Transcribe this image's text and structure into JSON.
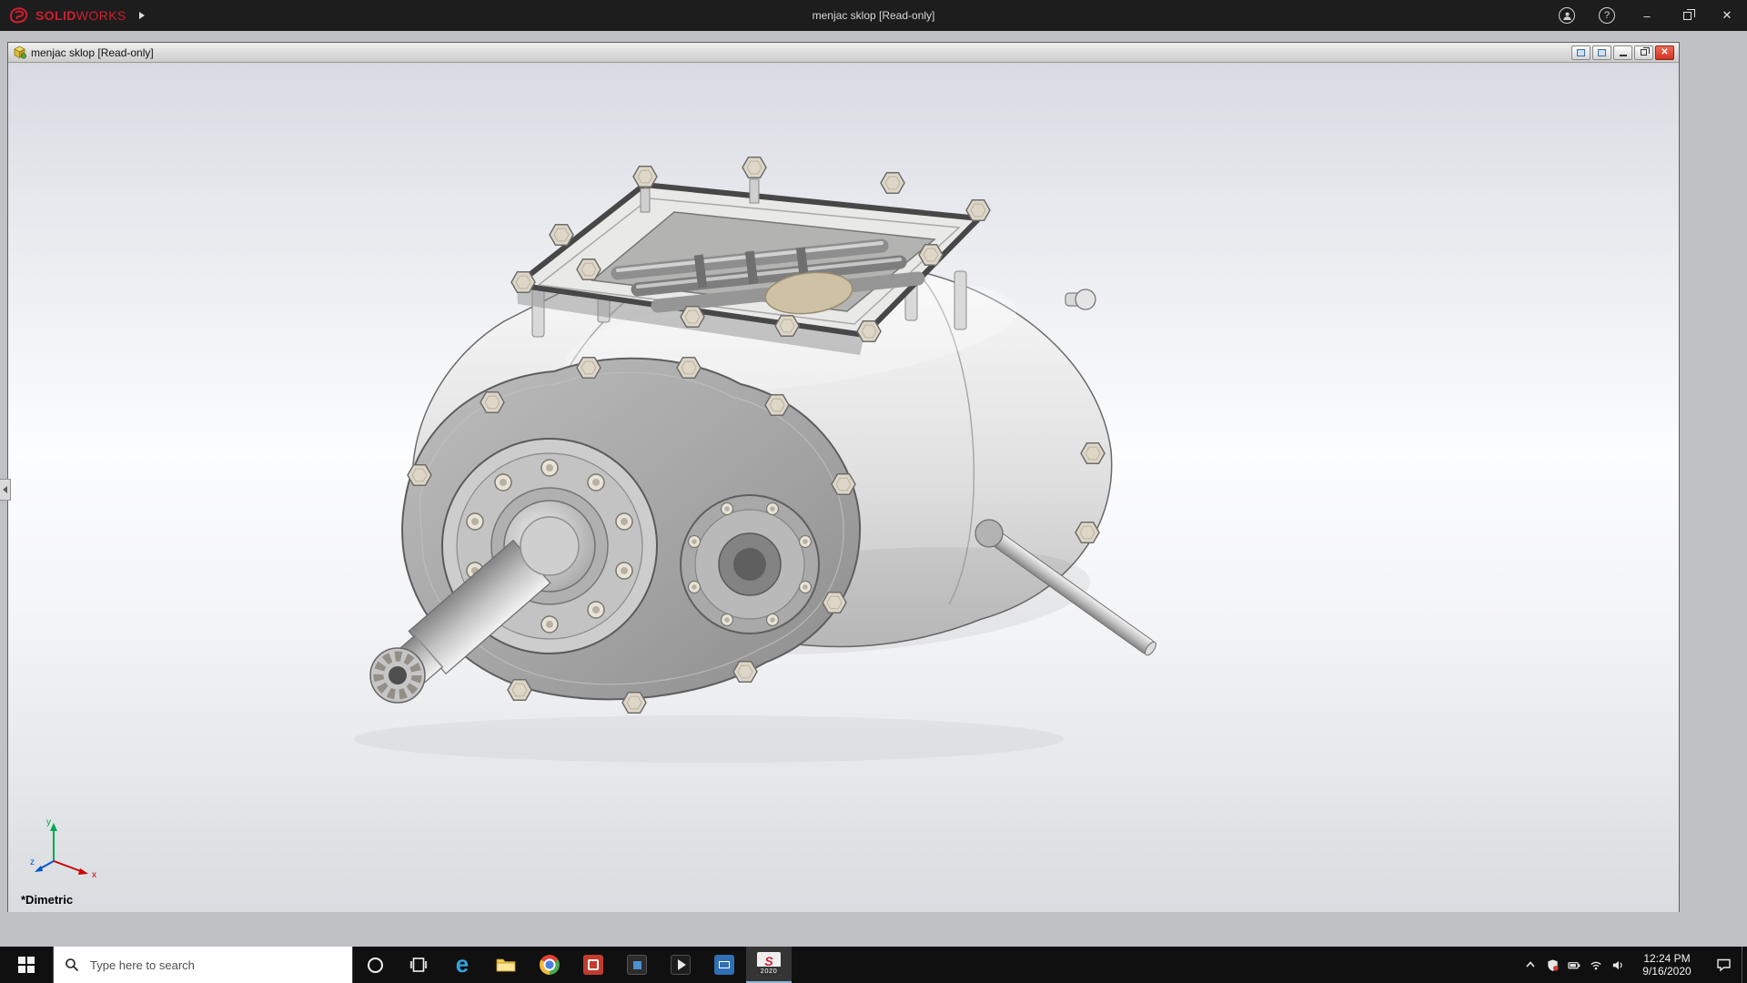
{
  "app_titlebar": {
    "logo_solid": "SOLID",
    "logo_works": "WORKS",
    "title": "menjac sklop [Read-only]",
    "controls": {
      "help": "?",
      "minimize": "–",
      "close": "✕"
    }
  },
  "document_window": {
    "title": "menjac sklop [Read-only]",
    "controls": {
      "close": "✕"
    },
    "view_label": "*Dimetric"
  },
  "viewport": {
    "triad": {
      "x_label": "x",
      "y_label": "y",
      "z_label": "z"
    }
  },
  "taskbar": {
    "search_placeholder": "Type here to search",
    "edge_glyph": "e",
    "sw_glyph": "S",
    "sw_badge": "2020",
    "clock": {
      "time": "12:24 PM",
      "date": "9/16/2020"
    }
  },
  "colors": {
    "accent_red": "#cf1f2f",
    "titlebar_bg": "#1d1d1d",
    "taskbar_bg": "#101010",
    "client_bg": "#bfc1c4",
    "close_button_red": "#cf3322",
    "triad_x": "#cc0000",
    "triad_y": "#00a650",
    "triad_z": "#0055cc"
  }
}
